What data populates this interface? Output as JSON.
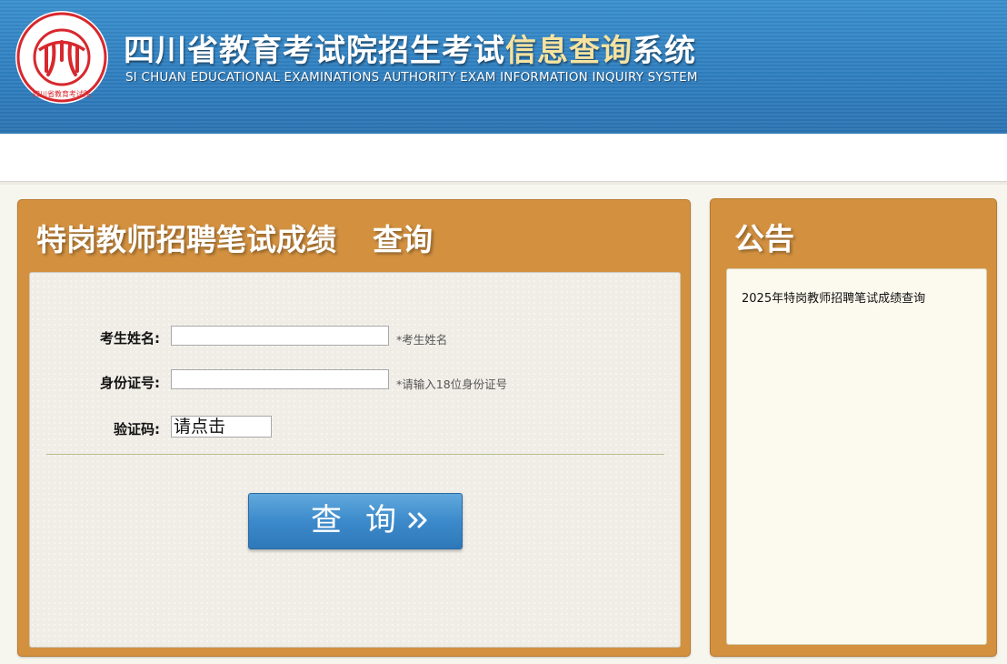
{
  "header": {
    "logo_text": "SI CHUAN EDUCATIONAL EXAMINATIONS AUTHORITY 四川省教育考试院",
    "title_part1": "四川省教育考试院招生考试",
    "title_highlight": "信息查询",
    "title_part2": "系统",
    "subtitle": "SI CHUAN EDUCATIONAL EXAMINATIONS AUTHORITY EXAM INFORMATION INQUIRY SYSTEM"
  },
  "query_panel": {
    "title": "特岗教师招聘笔试成绩",
    "title_suffix": "查询",
    "fields": [
      {
        "label": "考生姓名:",
        "value": "",
        "hint": "*考生姓名"
      },
      {
        "label": "身份证号:",
        "value": "",
        "hint": "*请输入18位身份证号"
      },
      {
        "label": "验证码:",
        "captcha_text": "请点击"
      }
    ],
    "submit_label": "查询",
    "submit_icon": "double-chevron-right-icon"
  },
  "notice_panel": {
    "title": "公告",
    "items": [
      "2025年特岗教师招聘笔试成绩查询"
    ]
  },
  "colors": {
    "header_blue": "#2f7fc0",
    "title_highlight": "#f6e3a0",
    "panel_orange": "#d39140",
    "button_blue": "#3c8acb"
  }
}
